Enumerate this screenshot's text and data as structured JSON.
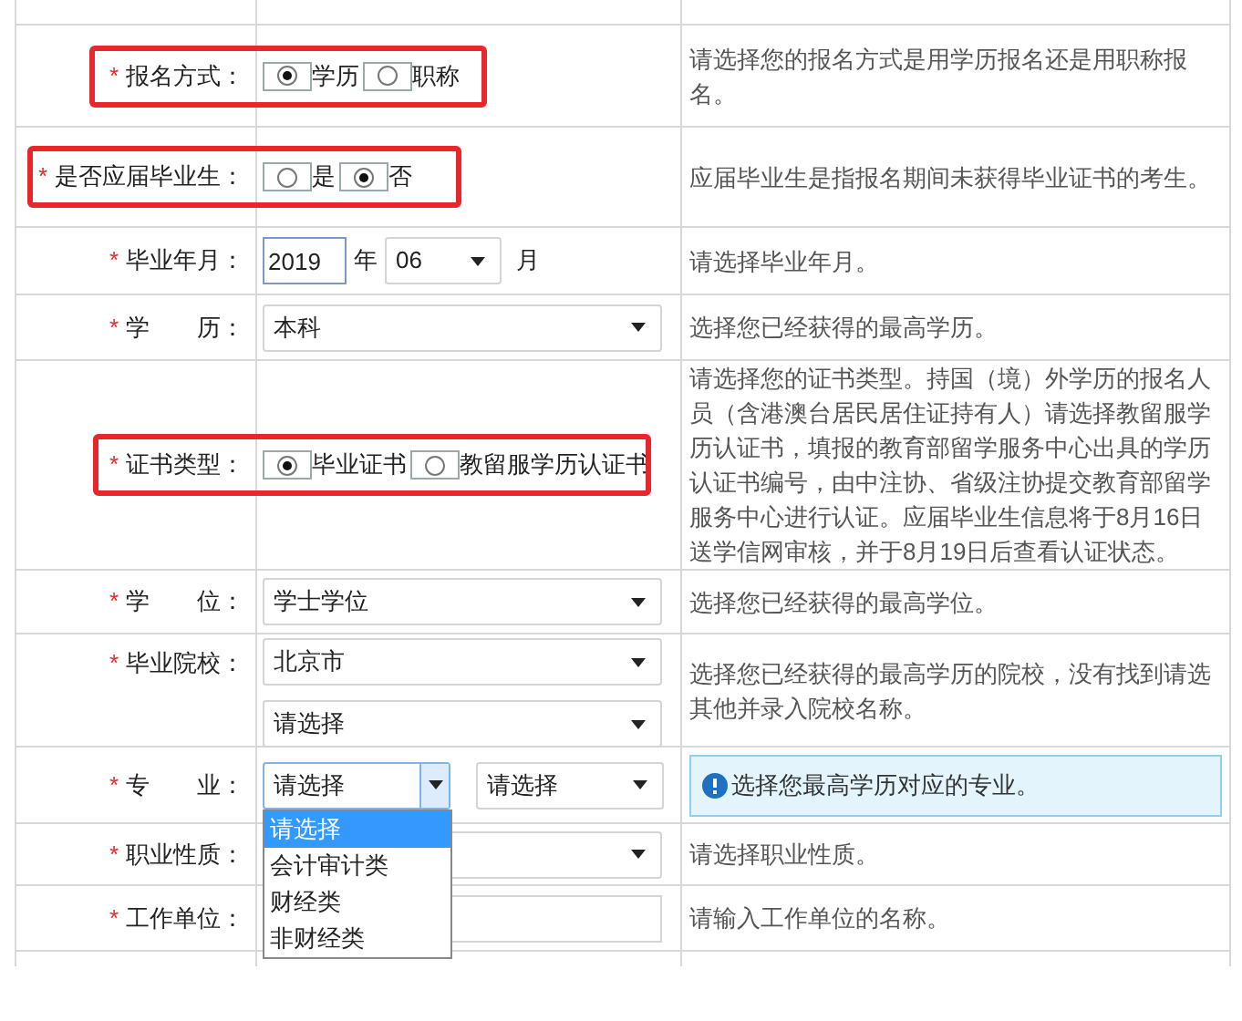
{
  "rows": [
    {
      "label": "报名方式：",
      "required_mark": "*",
      "highlighted": true,
      "kind": "radio",
      "options": [
        {
          "label": "学历",
          "selected": true
        },
        {
          "label": "职称",
          "selected": false
        }
      ],
      "hint": "请选择您的报名方式是用学历报名还是用职称报名。",
      "hint_boxed": false
    },
    {
      "label": "是否应届毕业生：",
      "required_mark": "*",
      "highlighted": true,
      "kind": "radio",
      "options": [
        {
          "label": "是",
          "selected": false
        },
        {
          "label": "否",
          "selected": true
        }
      ],
      "hint": "应届毕业生是指报名期间未获得毕业证书的考生。",
      "hint_boxed": false
    },
    {
      "label": "毕业年月：",
      "required_mark": "*",
      "highlighted": false,
      "kind": "date",
      "year": "2019",
      "year_unit": "年",
      "month": "06",
      "month_unit": "月",
      "hint": "请选择毕业年月。",
      "hint_boxed": false
    },
    {
      "label": "学　　历：",
      "required_mark": "*",
      "highlighted": false,
      "kind": "select",
      "selects": [
        {
          "value": "本科"
        }
      ],
      "hint": "选择您已经获得的最高学历。",
      "hint_boxed": false
    },
    {
      "label": "证书类型：",
      "required_mark": "*",
      "highlighted": true,
      "kind": "radio",
      "options": [
        {
          "label": "毕业证书",
          "selected": true
        },
        {
          "label": "教留服学历认证书",
          "selected": false
        }
      ],
      "hint": "请选择您的证书类型。持国（境）外学历的报名人员（含港澳台居民居住证持有人）请选择教留服学历认证书，填报的教育部留学服务中心出具的学历认证书编号，由中注协、省级注协提交教育部留学服务中心进行认证。应届毕业生信息将于8月16日送学信网审核，并于8月19日后查看认证状态。",
      "hint_boxed": false
    },
    {
      "label": "学　　位：",
      "required_mark": "*",
      "highlighted": false,
      "kind": "select",
      "selects": [
        {
          "value": "学士学位"
        }
      ],
      "hint": "选择您已经获得的最高学位。",
      "hint_boxed": false
    },
    {
      "label": "毕业院校：",
      "required_mark": "*",
      "highlighted": false,
      "kind": "select_stack",
      "selects": [
        {
          "value": "北京市"
        },
        {
          "value": "请选择"
        }
      ],
      "hint": "选择您已经获得的最高学历的院校，没有找到请选其他并录入院校名称。",
      "hint_boxed": false
    },
    {
      "label": "专　　业：",
      "required_mark": "*",
      "highlighted": false,
      "kind": "select_pair",
      "selects": [
        {
          "value": "请选择",
          "open": true,
          "options": [
            {
              "label": "请选择",
              "selected": true
            },
            {
              "label": "会计审计类",
              "selected": false
            },
            {
              "label": "财经类",
              "selected": false
            },
            {
              "label": "非财经类",
              "selected": false
            }
          ]
        },
        {
          "value": "请选择",
          "open": false
        }
      ],
      "hint": "选择您最高学历对应的专业。",
      "hint_boxed": true
    },
    {
      "label": "职业性质：",
      "required_mark": "*",
      "highlighted": false,
      "kind": "select",
      "hint": "请选择职业性质。",
      "hint_boxed": false
    },
    {
      "label": "工作单位：",
      "required_mark": "*",
      "highlighted": false,
      "kind": "input",
      "hint": "请输入工作单位的名称。",
      "hint_boxed": false
    }
  ]
}
